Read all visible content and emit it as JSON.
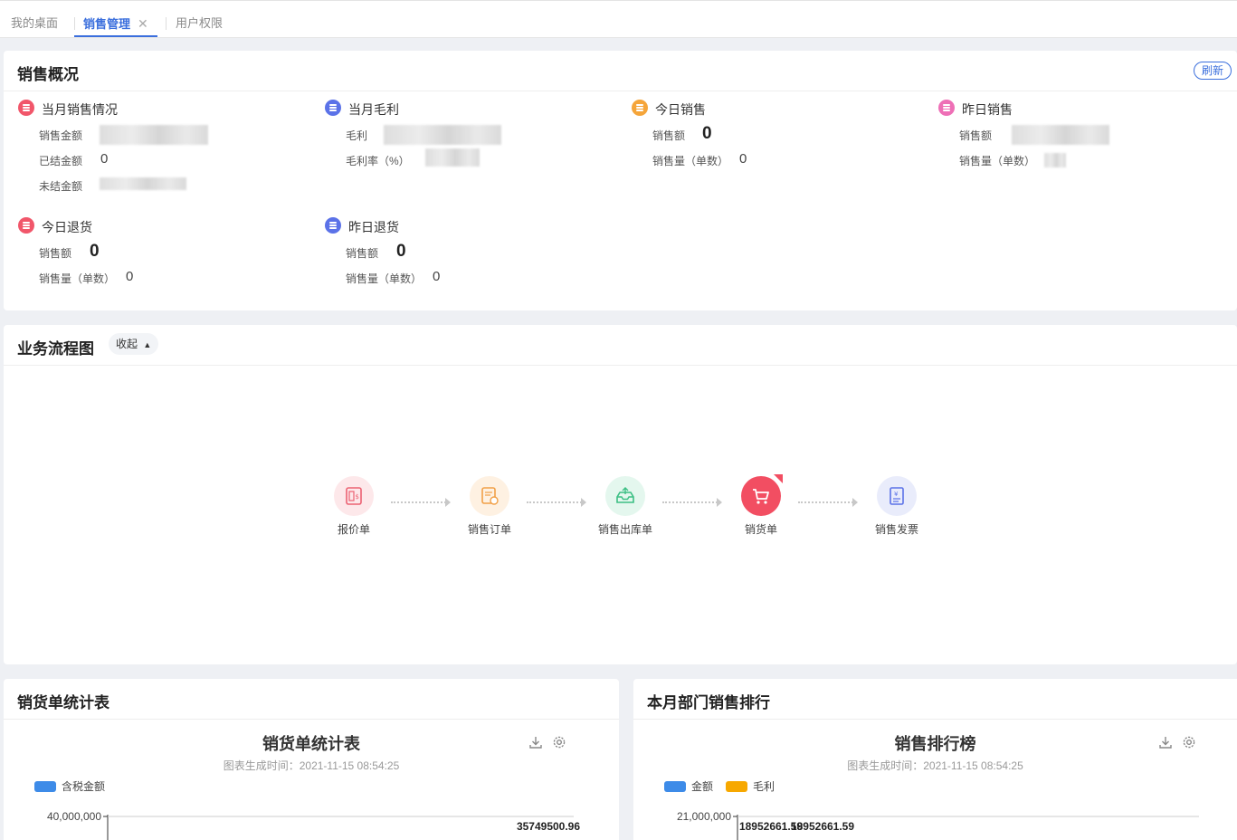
{
  "tabs": [
    {
      "label": "我的桌面",
      "active": false
    },
    {
      "label": "销售管理",
      "active": true,
      "close": "✕"
    },
    {
      "label": "用户权限",
      "active": false
    }
  ],
  "overview": {
    "title": "销售概况",
    "refresh_label": "刷新",
    "groups": [
      {
        "title": "当月销售情况",
        "color": "#f1566a",
        "rows": [
          {
            "label": "销售金额",
            "value": ""
          },
          {
            "label": "已结金额",
            "value": "0"
          },
          {
            "label": "未结金额",
            "value": ""
          }
        ]
      },
      {
        "title": "当月毛利",
        "color": "#5b72e8",
        "rows": [
          {
            "label": "毛利",
            "value": ""
          },
          {
            "label": "毛利率（%）",
            "value": ""
          }
        ]
      },
      {
        "title": "今日销售",
        "color": "#f5a53a",
        "rows": [
          {
            "label": "销售额",
            "value": "0"
          },
          {
            "label": "销售量（单数）",
            "value": "0"
          }
        ]
      },
      {
        "title": "昨日销售",
        "color": "#ee6fb6",
        "rows": [
          {
            "label": "销售额",
            "value": ""
          },
          {
            "label": "销售量（单数）",
            "value": ""
          }
        ]
      },
      {
        "title": "今日退货",
        "color": "#f1566a",
        "rows": [
          {
            "label": "销售额",
            "value": "0"
          },
          {
            "label": "销售量（单数）",
            "value": "0"
          }
        ]
      },
      {
        "title": "昨日退货",
        "color": "#5b72e8",
        "rows": [
          {
            "label": "销售额",
            "value": "0"
          },
          {
            "label": "销售量（单数）",
            "value": "0"
          }
        ]
      }
    ]
  },
  "flow": {
    "title": "业务流程图",
    "collapse_label": "收起",
    "nodes": [
      {
        "label": "报价单",
        "icon": "quote-doc-icon",
        "bg": "#fde8ea",
        "fg": "#ec6273"
      },
      {
        "label": "销售订单",
        "icon": "sales-order-icon",
        "bg": "#fef1e2",
        "fg": "#f1a047"
      },
      {
        "label": "销售出库单",
        "icon": "outbound-tray-icon",
        "bg": "#e4f7ee",
        "fg": "#3cbf84"
      },
      {
        "label": "销货单",
        "icon": "cart-icon",
        "bg": "#f24e62",
        "fg": "#ffffff"
      },
      {
        "label": "销售发票",
        "icon": "invoice-icon",
        "bg": "#e9ecfb",
        "fg": "#5b72e8"
      }
    ]
  },
  "stats_card": {
    "header": "销货单统计表",
    "chart_title": "销货单统计表",
    "generated": "图表生成时间：2021-11-15 08:54:25",
    "legend": [
      {
        "name": "含税金额",
        "color": "#3d8be8"
      }
    ]
  },
  "rank_card": {
    "header": "本月部门销售排行",
    "chart_title": "销售排行榜",
    "generated": "图表生成时间：2021-11-15 08:54:25",
    "legend": [
      {
        "name": "金额",
        "color": "#3d8be8"
      },
      {
        "name": "毛利",
        "color": "#f7a800"
      }
    ]
  },
  "chart_data": [
    {
      "type": "bar",
      "title": "销货单统计表",
      "series": [
        {
          "name": "含税金额",
          "values": [
            35749500.96
          ]
        }
      ],
      "y_ticks": [
        "40,000,000"
      ],
      "data_labels": [
        "35749500.96"
      ]
    },
    {
      "type": "bar",
      "title": "销售排行榜",
      "series": [
        {
          "name": "金额",
          "values": [
            18952661.59
          ]
        },
        {
          "name": "毛利",
          "values": [
            18952661.59
          ]
        }
      ],
      "y_ticks": [
        "21,000,000"
      ],
      "data_labels": [
        "18952661.59",
        "18952661.59"
      ]
    }
  ]
}
